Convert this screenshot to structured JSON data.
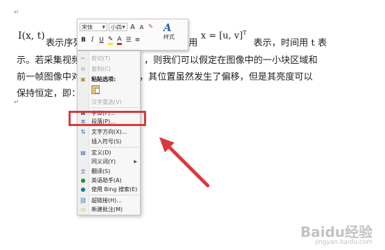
{
  "document": {
    "lines": [
      "表示序列图",
      "坐标用",
      "表示，时间用 t 表",
      "示。若采集视频",
      "，则我们可以假定在图像中的一小块区域和",
      "前一帧图像中对",
      "，其位置虽然发生了偏移，但是其亮度可以",
      "保持恒定，即："
    ],
    "formula_i": "I(x, t)",
    "formula_x": "x = [u, v]",
    "formula_sup": "T",
    "para_mark": "↵"
  },
  "mini_toolbar": {
    "font": "宋体",
    "size": "小四",
    "grow_font": "A",
    "shrink_font": "A",
    "bold": "B",
    "italic": "I",
    "underline": "U",
    "styles": "样式"
  },
  "context_menu": {
    "items": [
      {
        "icon": "scissors-icon",
        "glyph": "✂",
        "label": "剪切(T)",
        "disabled": true
      },
      {
        "icon": "copy-icon",
        "glyph": "⧉",
        "label": "复制(C)",
        "disabled": true
      },
      {
        "icon": "paste-icon",
        "glyph": "📋",
        "label": "粘贴选项:",
        "disabled": false
      },
      {
        "icon": "chinese-convert-icon",
        "glyph": "",
        "label": "汉字重选(V)",
        "disabled": true
      },
      {
        "icon": "font-icon",
        "glyph": "A",
        "label": "字体(F)...",
        "disabled": false
      },
      {
        "icon": "paragraph-icon",
        "glyph": "≣",
        "label": "段落(P)...",
        "disabled": false
      },
      {
        "icon": "text-direction-icon",
        "glyph": "⇅",
        "label": "文字方向(X)...",
        "disabled": false
      },
      {
        "icon": "",
        "glyph": "",
        "label": "插入符号(S)",
        "disabled": false
      },
      {
        "icon": "define-icon",
        "glyph": "📖",
        "label": "定义(D)",
        "disabled": false
      },
      {
        "icon": "",
        "glyph": "",
        "label": "同义词(Y)",
        "disabled": false,
        "submenu": true
      },
      {
        "icon": "translate-icon",
        "glyph": "文",
        "label": "翻译(S)",
        "disabled": false
      },
      {
        "icon": "english-assistant-icon",
        "glyph": "a",
        "label": "英语助手(A)",
        "disabled": false
      },
      {
        "icon": "bing-search-icon",
        "glyph": "🔍",
        "label": "使用 Bing 搜索(E)",
        "disabled": false
      },
      {
        "icon": "hyperlink-icon",
        "glyph": "🔗",
        "label": "超链接(H)...",
        "disabled": false
      },
      {
        "icon": "new-comment-icon",
        "glyph": "💬",
        "label": "新建批注(M)",
        "disabled": false
      }
    ]
  },
  "watermark": {
    "logo": "Baidu经验",
    "url": "jingyan.baidu.com"
  },
  "colors": {
    "highlight": "#d8393a",
    "arrow": "#d8393a"
  }
}
